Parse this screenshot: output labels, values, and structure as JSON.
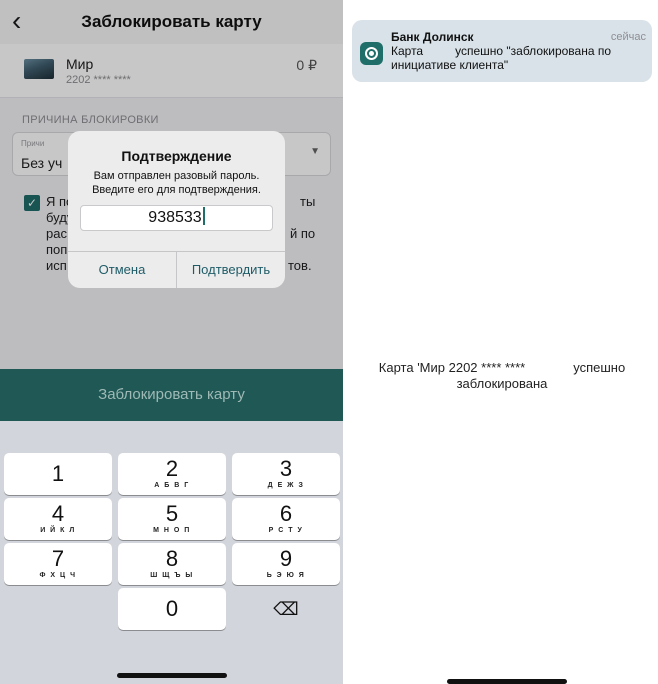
{
  "left": {
    "nav": {
      "back_glyph": "‹",
      "title": "Заблокировать карту"
    },
    "card": {
      "name": "Мир",
      "number": "2202 **** ****",
      "amount": "0 ₽"
    },
    "reason": {
      "section_label": "ПРИЧИНА БЛОКИРОВКИ",
      "caption": "Причи",
      "value": "Без уч",
      "chevron": "▼"
    },
    "agreement": {
      "checked": true,
      "check_glyph": "✓",
      "lines": [
        "Я по",
        "буду",
        "рас",
        "поп",
        "исп"
      ],
      "line_ends": [
        "ты",
        "",
        "й по",
        "",
        "тов."
      ]
    },
    "block_button_label": "Заблокировать карту",
    "dialog": {
      "title": "Подтверждение",
      "message": "Вам отправлен разовый пароль. Введите его для подтверждения.",
      "input_value": "938533",
      "cancel_label": "Отмена",
      "confirm_label": "Подтвердить"
    },
    "keypad": {
      "keys": [
        {
          "digit": "1",
          "letters": ""
        },
        {
          "digit": "2",
          "letters": "А Б В Г"
        },
        {
          "digit": "3",
          "letters": "Д Е Ж З"
        },
        {
          "digit": "4",
          "letters": "И Й К Л"
        },
        {
          "digit": "5",
          "letters": "М Н О П"
        },
        {
          "digit": "6",
          "letters": "Р С Т У"
        },
        {
          "digit": "7",
          "letters": "Ф Х Ц Ч"
        },
        {
          "digit": "8",
          "letters": "Ш Щ Ъ Ы"
        },
        {
          "digit": "9",
          "letters": "Ь Э Ю Я"
        },
        {
          "digit": "0",
          "letters": ""
        }
      ],
      "backspace_glyph": "⌫"
    }
  },
  "right": {
    "notification": {
      "app_name": "Банк Долинск",
      "time": "сейчас",
      "body_start": "Карта",
      "body_end": "успешно \"заблокирована по инициативе клиента\""
    },
    "result": {
      "part1": "Карта 'Мир 2202 **** ****",
      "part2": "успешно заблокирована"
    }
  },
  "colors": {
    "accent": "#1f6e6a",
    "block_button_bg": "#1f5854",
    "dialog_button_text": "#1f5c68",
    "notification_bg": "#d8e2e8"
  },
  "icons": {
    "back": "chevron-left-icon",
    "card": "card-thumbnail-icon",
    "checkbox": "checkmark-icon",
    "backspace": "backspace-icon",
    "app": "bank-app-icon"
  }
}
